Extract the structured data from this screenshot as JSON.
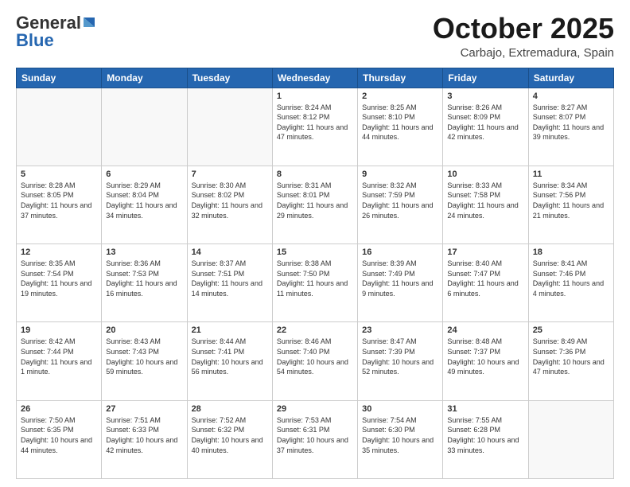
{
  "header": {
    "logo_general": "General",
    "logo_blue": "Blue",
    "month_title": "October 2025",
    "location": "Carbajo, Extremadura, Spain"
  },
  "days_of_week": [
    "Sunday",
    "Monday",
    "Tuesday",
    "Wednesday",
    "Thursday",
    "Friday",
    "Saturday"
  ],
  "weeks": [
    [
      {
        "day": "",
        "info": ""
      },
      {
        "day": "",
        "info": ""
      },
      {
        "day": "",
        "info": ""
      },
      {
        "day": "1",
        "info": "Sunrise: 8:24 AM\nSunset: 8:12 PM\nDaylight: 11 hours and 47 minutes."
      },
      {
        "day": "2",
        "info": "Sunrise: 8:25 AM\nSunset: 8:10 PM\nDaylight: 11 hours and 44 minutes."
      },
      {
        "day": "3",
        "info": "Sunrise: 8:26 AM\nSunset: 8:09 PM\nDaylight: 11 hours and 42 minutes."
      },
      {
        "day": "4",
        "info": "Sunrise: 8:27 AM\nSunset: 8:07 PM\nDaylight: 11 hours and 39 minutes."
      }
    ],
    [
      {
        "day": "5",
        "info": "Sunrise: 8:28 AM\nSunset: 8:05 PM\nDaylight: 11 hours and 37 minutes."
      },
      {
        "day": "6",
        "info": "Sunrise: 8:29 AM\nSunset: 8:04 PM\nDaylight: 11 hours and 34 minutes."
      },
      {
        "day": "7",
        "info": "Sunrise: 8:30 AM\nSunset: 8:02 PM\nDaylight: 11 hours and 32 minutes."
      },
      {
        "day": "8",
        "info": "Sunrise: 8:31 AM\nSunset: 8:01 PM\nDaylight: 11 hours and 29 minutes."
      },
      {
        "day": "9",
        "info": "Sunrise: 8:32 AM\nSunset: 7:59 PM\nDaylight: 11 hours and 26 minutes."
      },
      {
        "day": "10",
        "info": "Sunrise: 8:33 AM\nSunset: 7:58 PM\nDaylight: 11 hours and 24 minutes."
      },
      {
        "day": "11",
        "info": "Sunrise: 8:34 AM\nSunset: 7:56 PM\nDaylight: 11 hours and 21 minutes."
      }
    ],
    [
      {
        "day": "12",
        "info": "Sunrise: 8:35 AM\nSunset: 7:54 PM\nDaylight: 11 hours and 19 minutes."
      },
      {
        "day": "13",
        "info": "Sunrise: 8:36 AM\nSunset: 7:53 PM\nDaylight: 11 hours and 16 minutes."
      },
      {
        "day": "14",
        "info": "Sunrise: 8:37 AM\nSunset: 7:51 PM\nDaylight: 11 hours and 14 minutes."
      },
      {
        "day": "15",
        "info": "Sunrise: 8:38 AM\nSunset: 7:50 PM\nDaylight: 11 hours and 11 minutes."
      },
      {
        "day": "16",
        "info": "Sunrise: 8:39 AM\nSunset: 7:49 PM\nDaylight: 11 hours and 9 minutes."
      },
      {
        "day": "17",
        "info": "Sunrise: 8:40 AM\nSunset: 7:47 PM\nDaylight: 11 hours and 6 minutes."
      },
      {
        "day": "18",
        "info": "Sunrise: 8:41 AM\nSunset: 7:46 PM\nDaylight: 11 hours and 4 minutes."
      }
    ],
    [
      {
        "day": "19",
        "info": "Sunrise: 8:42 AM\nSunset: 7:44 PM\nDaylight: 11 hours and 1 minute."
      },
      {
        "day": "20",
        "info": "Sunrise: 8:43 AM\nSunset: 7:43 PM\nDaylight: 10 hours and 59 minutes."
      },
      {
        "day": "21",
        "info": "Sunrise: 8:44 AM\nSunset: 7:41 PM\nDaylight: 10 hours and 56 minutes."
      },
      {
        "day": "22",
        "info": "Sunrise: 8:46 AM\nSunset: 7:40 PM\nDaylight: 10 hours and 54 minutes."
      },
      {
        "day": "23",
        "info": "Sunrise: 8:47 AM\nSunset: 7:39 PM\nDaylight: 10 hours and 52 minutes."
      },
      {
        "day": "24",
        "info": "Sunrise: 8:48 AM\nSunset: 7:37 PM\nDaylight: 10 hours and 49 minutes."
      },
      {
        "day": "25",
        "info": "Sunrise: 8:49 AM\nSunset: 7:36 PM\nDaylight: 10 hours and 47 minutes."
      }
    ],
    [
      {
        "day": "26",
        "info": "Sunrise: 7:50 AM\nSunset: 6:35 PM\nDaylight: 10 hours and 44 minutes."
      },
      {
        "day": "27",
        "info": "Sunrise: 7:51 AM\nSunset: 6:33 PM\nDaylight: 10 hours and 42 minutes."
      },
      {
        "day": "28",
        "info": "Sunrise: 7:52 AM\nSunset: 6:32 PM\nDaylight: 10 hours and 40 minutes."
      },
      {
        "day": "29",
        "info": "Sunrise: 7:53 AM\nSunset: 6:31 PM\nDaylight: 10 hours and 37 minutes."
      },
      {
        "day": "30",
        "info": "Sunrise: 7:54 AM\nSunset: 6:30 PM\nDaylight: 10 hours and 35 minutes."
      },
      {
        "day": "31",
        "info": "Sunrise: 7:55 AM\nSunset: 6:28 PM\nDaylight: 10 hours and 33 minutes."
      },
      {
        "day": "",
        "info": ""
      }
    ]
  ]
}
